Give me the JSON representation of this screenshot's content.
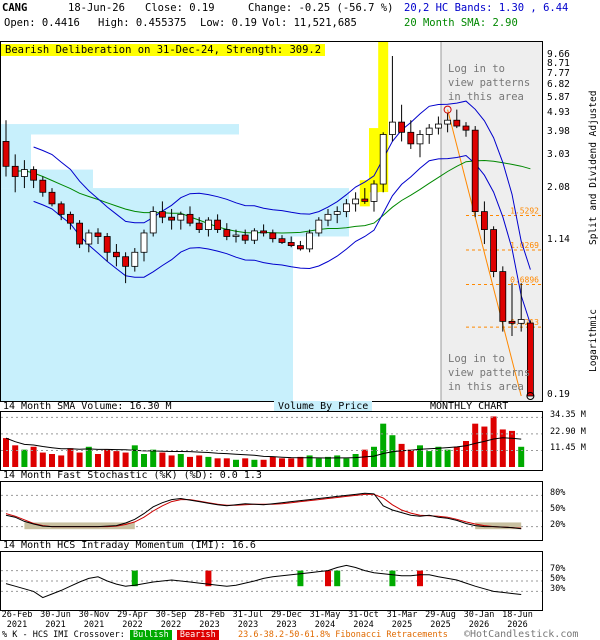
{
  "header": {
    "ticker": "CANG",
    "date": "18-Jun-26",
    "close": "Close: 0.19",
    "change": "Change: -0.25 (-56.7 %)",
    "open": "Open: 0.4416",
    "high": "High: 0.455375",
    "low": "Low: 0.19",
    "vol": "Vol: 11,521,685",
    "bands": "20,2 HC Bands: 1.30 , 6.44",
    "sma": "20 Month SMA: 2.90"
  },
  "banner": "Bearish Deliberation on 31-Dec-24, Strength: 309.2",
  "login_text": [
    "Log in to",
    "view patterns",
    "in this area"
  ],
  "right_axis_label": "Split and Dividend Adjusted",
  "log_label": "Logarithmic",
  "price_panel": {
    "title_left": "14 Month SMA Volume: 16.30 M",
    "title_mid": "Volume By Price",
    "title_right": "MONTHLY CHART"
  },
  "stoch_title": "14 Month Fast Stochastic (%K) (%D): 0.0  1.3",
  "imi_title": "14 Month HCS Intraday Momentum (IMI): 16.6",
  "footer": {
    "k_imi": "% K - HCS IMI Crossover:",
    "bullish": "Bullish",
    "bearish": "Bearish",
    "fib": "23.6-38.2-50-61.8% Fibonacci Retracements",
    "copyright": "©HotCandlestick.com"
  },
  "colors": {
    "up": "#00aa00",
    "down": "#dd0000",
    "band": "#0000cc",
    "sma": "#008800",
    "fib": "#ff8800",
    "vbp": "#c8f0fc",
    "highlight": "#ffff00",
    "stoch_k": "#000000",
    "stoch_d": "#cc0000",
    "shade": "#c8c0a0"
  },
  "chart_data": {
    "type": "candlestick",
    "scale": "log",
    "y_ticks": [
      "9.66",
      "8.71",
      "7.77",
      "6.82",
      "5.87",
      "4.93",
      "3.98",
      "3.03",
      "2.08",
      "1.14",
      "0.19"
    ],
    "fib_levels": [
      "1.5292",
      "1.0269",
      "0.6896",
      "0.4213"
    ],
    "volume_ticks": [
      "34.35 M",
      "22.90 M",
      "11.45 M"
    ],
    "stoch_ticks": [
      "80%",
      "50%",
      "20%"
    ],
    "imi_ticks": [
      "70%",
      "50%",
      "30%"
    ],
    "x_labels": [
      "26-Feb\n2021",
      "30-Jun\n2021",
      "30-Nov\n2021",
      "29-Apr\n2022",
      "30-Sep\n2022",
      "28-Feb\n2023",
      "31-Jul\n2023",
      "29-Dec\n2023",
      "31-May\n2024",
      "31-Oct\n2024",
      "31-Mar\n2025",
      "29-Aug\n2025",
      "30-Jan\n2026",
      "18-Jun\n2026"
    ],
    "candles": [
      {
        "o": 3.6,
        "h": 4.6,
        "l": 2.4,
        "c": 2.7
      },
      {
        "o": 2.7,
        "h": 3.1,
        "l": 2.0,
        "c": 2.4
      },
      {
        "o": 2.4,
        "h": 2.9,
        "l": 2.1,
        "c": 2.6
      },
      {
        "o": 2.6,
        "h": 2.7,
        "l": 2.1,
        "c": 2.3
      },
      {
        "o": 2.3,
        "h": 2.4,
        "l": 1.9,
        "c": 2.0
      },
      {
        "o": 2.0,
        "h": 2.1,
        "l": 1.7,
        "c": 1.75
      },
      {
        "o": 1.75,
        "h": 1.8,
        "l": 1.45,
        "c": 1.55
      },
      {
        "o": 1.55,
        "h": 1.6,
        "l": 1.3,
        "c": 1.4
      },
      {
        "o": 1.4,
        "h": 1.45,
        "l": 1.05,
        "c": 1.1
      },
      {
        "o": 1.1,
        "h": 1.3,
        "l": 1.0,
        "c": 1.25
      },
      {
        "o": 1.25,
        "h": 1.32,
        "l": 1.1,
        "c": 1.2
      },
      {
        "o": 1.2,
        "h": 1.25,
        "l": 0.9,
        "c": 1.0
      },
      {
        "o": 1.0,
        "h": 1.1,
        "l": 0.85,
        "c": 0.95
      },
      {
        "o": 0.95,
        "h": 1.0,
        "l": 0.7,
        "c": 0.85
      },
      {
        "o": 0.85,
        "h": 1.05,
        "l": 0.8,
        "c": 1.0
      },
      {
        "o": 1.0,
        "h": 1.3,
        "l": 0.9,
        "c": 1.25
      },
      {
        "o": 1.25,
        "h": 1.7,
        "l": 1.2,
        "c": 1.6
      },
      {
        "o": 1.6,
        "h": 1.8,
        "l": 1.4,
        "c": 1.5
      },
      {
        "o": 1.5,
        "h": 1.65,
        "l": 1.3,
        "c": 1.45
      },
      {
        "o": 1.45,
        "h": 1.6,
        "l": 1.3,
        "c": 1.55
      },
      {
        "o": 1.55,
        "h": 1.7,
        "l": 1.35,
        "c": 1.4
      },
      {
        "o": 1.4,
        "h": 1.5,
        "l": 1.25,
        "c": 1.3
      },
      {
        "o": 1.3,
        "h": 1.5,
        "l": 1.2,
        "c": 1.45
      },
      {
        "o": 1.45,
        "h": 1.55,
        "l": 1.25,
        "c": 1.3
      },
      {
        "o": 1.3,
        "h": 1.4,
        "l": 1.15,
        "c": 1.2
      },
      {
        "o": 1.2,
        "h": 1.3,
        "l": 1.12,
        "c": 1.22
      },
      {
        "o": 1.22,
        "h": 1.3,
        "l": 1.1,
        "c": 1.15
      },
      {
        "o": 1.15,
        "h": 1.32,
        "l": 1.1,
        "c": 1.28
      },
      {
        "o": 1.28,
        "h": 1.38,
        "l": 1.2,
        "c": 1.25
      },
      {
        "o": 1.25,
        "h": 1.3,
        "l": 1.12,
        "c": 1.17
      },
      {
        "o": 1.17,
        "h": 1.22,
        "l": 1.1,
        "c": 1.12
      },
      {
        "o": 1.12,
        "h": 1.2,
        "l": 1.06,
        "c": 1.08
      },
      {
        "o": 1.08,
        "h": 1.14,
        "l": 1.02,
        "c": 1.04
      },
      {
        "o": 1.04,
        "h": 1.3,
        "l": 1.0,
        "c": 1.25
      },
      {
        "o": 1.25,
        "h": 1.5,
        "l": 1.2,
        "c": 1.45
      },
      {
        "o": 1.45,
        "h": 1.65,
        "l": 1.35,
        "c": 1.55
      },
      {
        "o": 1.55,
        "h": 1.7,
        "l": 1.4,
        "c": 1.6
      },
      {
        "o": 1.6,
        "h": 1.85,
        "l": 1.5,
        "c": 1.75
      },
      {
        "o": 1.75,
        "h": 2.0,
        "l": 1.6,
        "c": 1.85
      },
      {
        "o": 1.85,
        "h": 2.1,
        "l": 1.75,
        "c": 1.8
      },
      {
        "o": 1.8,
        "h": 2.3,
        "l": 1.6,
        "c": 2.2
      },
      {
        "o": 2.2,
        "h": 4.0,
        "l": 2.0,
        "c": 3.9
      },
      {
        "o": 3.9,
        "h": 9.66,
        "l": 3.6,
        "c": 4.5
      },
      {
        "o": 4.5,
        "h": 5.5,
        "l": 3.6,
        "c": 4.0
      },
      {
        "o": 4.0,
        "h": 4.6,
        "l": 3.3,
        "c": 3.5
      },
      {
        "o": 3.5,
        "h": 4.1,
        "l": 3.0,
        "c": 3.9
      },
      {
        "o": 3.9,
        "h": 4.4,
        "l": 3.5,
        "c": 4.2
      },
      {
        "o": 4.2,
        "h": 4.8,
        "l": 3.9,
        "c": 4.4
      },
      {
        "o": 4.4,
        "h": 5.0,
        "l": 4.0,
        "c": 4.6
      },
      {
        "o": 4.6,
        "h": 5.2,
        "l": 4.2,
        "c": 4.3
      },
      {
        "o": 4.3,
        "h": 4.5,
        "l": 3.8,
        "c": 4.1
      },
      {
        "o": 4.1,
        "h": 4.3,
        "l": 1.5,
        "c": 1.6
      },
      {
        "o": 1.6,
        "h": 1.8,
        "l": 1.1,
        "c": 1.3
      },
      {
        "o": 1.3,
        "h": 1.35,
        "l": 0.75,
        "c": 0.8
      },
      {
        "o": 0.8,
        "h": 0.85,
        "l": 0.4,
        "c": 0.45
      },
      {
        "o": 0.45,
        "h": 0.7,
        "l": 0.38,
        "c": 0.44
      },
      {
        "o": 0.44,
        "h": 0.7,
        "l": 0.4,
        "c": 0.46
      },
      {
        "o": 0.4416,
        "h": 0.455375,
        "l": 0.19,
        "c": 0.19
      }
    ],
    "volume": [
      20,
      15,
      12,
      14,
      10,
      9,
      8,
      13,
      10,
      14,
      9,
      12,
      11,
      10,
      15,
      9,
      12,
      10,
      8,
      9,
      7,
      8,
      7,
      6,
      6,
      5,
      6,
      5,
      5,
      7,
      6,
      6,
      7,
      8,
      6,
      7,
      8,
      6,
      9,
      12,
      14,
      30,
      22,
      16,
      12,
      15,
      11,
      14,
      12,
      14,
      18,
      30,
      28,
      35,
      26,
      25,
      14
    ],
    "stoch_k": [
      42,
      38,
      30,
      25,
      21,
      20,
      20,
      20,
      20,
      20,
      20,
      21,
      22,
      27,
      34,
      45,
      58,
      66,
      72,
      74,
      71,
      68,
      65,
      62,
      60,
      62,
      64,
      63,
      62,
      64,
      66,
      68,
      70,
      72,
      74,
      76,
      78,
      80,
      82,
      84,
      83,
      60,
      52,
      47,
      42,
      40,
      42,
      38,
      36,
      32,
      26,
      22,
      20,
      20,
      19,
      18,
      16
    ],
    "stoch_d": [
      45,
      40,
      33,
      26,
      22,
      20,
      20,
      20,
      20,
      20,
      20,
      20,
      21,
      24,
      29,
      38,
      50,
      60,
      68,
      72,
      72,
      69,
      66,
      63,
      61,
      61,
      62,
      63,
      63,
      63,
      64,
      66,
      68,
      70,
      72,
      74,
      76,
      78,
      80,
      82,
      82,
      75,
      62,
      52,
      46,
      42,
      41,
      40,
      38,
      34,
      29,
      25,
      22,
      20,
      19,
      18,
      17
    ],
    "imi": [
      45,
      40,
      35,
      30,
      18,
      25,
      32,
      40,
      48,
      55,
      58,
      50,
      44,
      40,
      42,
      45,
      48,
      50,
      52,
      50,
      48,
      46,
      44,
      42,
      40,
      42,
      46,
      50,
      55,
      58,
      60,
      62,
      64,
      66,
      68,
      70,
      76,
      80,
      76,
      70,
      66,
      64,
      62,
      60,
      60,
      62,
      62,
      58,
      55,
      52,
      46,
      40,
      35,
      30,
      28,
      26,
      24
    ],
    "bullish_bars": [
      14,
      32,
      36,
      42
    ],
    "bearish_bars": [
      22,
      35,
      45
    ]
  }
}
